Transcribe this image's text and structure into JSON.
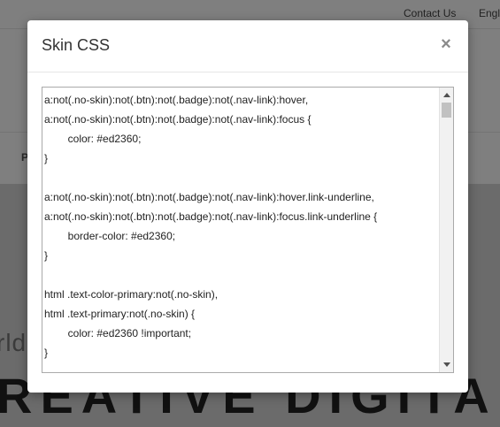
{
  "top_bar": {
    "contact_link": "Contact Us",
    "language_link": "Engli"
  },
  "nav": {
    "first_item_letter": "P"
  },
  "hero": {
    "small_text": "rld",
    "big_text": "REATIVE DIGITA"
  },
  "modal": {
    "title": "Skin CSS",
    "close_label": "×",
    "css_content": "a:not(.no-skin):not(.btn):not(.badge):not(.nav-link):hover,\na:not(.no-skin):not(.btn):not(.badge):not(.nav-link):focus {\n        color: #ed2360;\n}\n\na:not(.no-skin):not(.btn):not(.badge):not(.nav-link):hover.link-underline,\na:not(.no-skin):not(.btn):not(.badge):not(.nav-link):focus.link-underline {\n        border-color: #ed2360;\n}\n\nhtml .text-color-primary:not(.no-skin),\nhtml .text-primary:not(.no-skin) {\n        color: #ed2360 !important;\n}"
  },
  "colors": {
    "overlay": "#7b7b7b",
    "modal_bg": "#ffffff",
    "skin_primary": "#ed2360"
  },
  "icons": {
    "close": "close-icon",
    "scroll_up": "chevron-up-icon",
    "scroll_down": "chevron-down-icon"
  }
}
